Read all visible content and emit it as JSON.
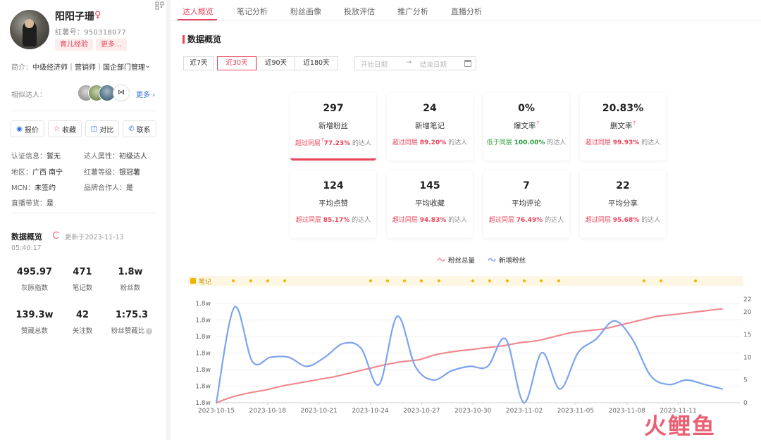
{
  "profile": {
    "name": "阳阳子珊",
    "gender_symbol": "♀",
    "red_id": "红薯号：950318077",
    "tags": [
      "育儿经验",
      "更多..."
    ],
    "bio_label": "简介：",
    "bio_text": "中级经济师｜营销师｜国企部门管理",
    "similar_label": "相似达人：",
    "similar_more": "更多",
    "actions": [
      "报价",
      "收藏",
      "对比",
      "联系"
    ],
    "info": [
      {
        "k": "认证信息：",
        "v": "暂无"
      },
      {
        "k": "达人属性：",
        "v": "初级达人"
      },
      {
        "k": "地区：",
        "v": "广西 南宁"
      },
      {
        "k": "红薯等级：",
        "v": "银冠薯"
      },
      {
        "k": "MCN：",
        "v": "未签约"
      },
      {
        "k": "品牌合作人：",
        "v": "是"
      },
      {
        "k": "直播带货：",
        "v": "是"
      }
    ],
    "overview_title": "数据概览",
    "updated_label": "更新于2023-11-13",
    "updated_time": "05:40:17",
    "stats": [
      {
        "value": "495.97",
        "label": "灰豚指数"
      },
      {
        "value": "471",
        "label": "笔记数"
      },
      {
        "value": "1.8w",
        "label": "粉丝数"
      },
      {
        "value": "139.3w",
        "label": "赞藏总数"
      },
      {
        "value": "42",
        "label": "关注数"
      },
      {
        "value": "1:75.3",
        "label": "粉丝赞藏比"
      }
    ]
  },
  "tabs": [
    "达人概览",
    "笔记分析",
    "粉丝画像",
    "投放评估",
    "推广分析",
    "直播分析"
  ],
  "active_tab": "达人概览",
  "section_title": "数据概览",
  "ranges": [
    "近7天",
    "近30天",
    "近90天",
    "近180天"
  ],
  "active_range": "近30天",
  "date_picker": {
    "start_placeholder": "开始日期",
    "end_placeholder": "结束日期"
  },
  "cards": [
    {
      "value": "297",
      "label": "新增粉丝",
      "prefix": "超过同层",
      "pct": "77.23%",
      "suffix": "的达人"
    },
    {
      "value": "24",
      "label": "新增笔记",
      "prefix": "超过同层",
      "pct": "89.20%",
      "suffix": "的达人"
    },
    {
      "value": "0%",
      "label": "爆文率",
      "prefix": "低于同层",
      "pct": "100.00%",
      "suffix": "的达人"
    },
    {
      "value": "20.83%",
      "label": "删文率",
      "prefix": "超过同层",
      "pct": "99.93%",
      "suffix": "的达人"
    },
    {
      "value": "124",
      "label": "平均点赞",
      "prefix": "超过同层",
      "pct": "85.17%",
      "suffix": "的达人"
    },
    {
      "value": "145",
      "label": "平均收藏",
      "prefix": "超过同层",
      "pct": "94.83%",
      "suffix": "的达人"
    },
    {
      "value": "7",
      "label": "平均评论",
      "prefix": "超过同层",
      "pct": "76.49%",
      "suffix": "的达人"
    },
    {
      "value": "22",
      "label": "平均分享",
      "prefix": "超过同层",
      "pct": "95.68%",
      "suffix": "的达人"
    }
  ],
  "legend": [
    "粉丝总量",
    "新增粉丝"
  ],
  "notes_label": "笔记",
  "watermark": "火鲤鱼",
  "colors": {
    "accent": "#e8445a",
    "total_line": "#f08a8f",
    "new_line": "#7ba3f0",
    "note_dot": "#f0b400",
    "green": "#2e9a3a"
  },
  "chart_data": {
    "type": "line",
    "x_tick_labels": [
      "2023-10-15",
      "2023-10-18",
      "2023-10-21",
      "2023-10-24",
      "2023-10-27",
      "2023-10-30",
      "2023-11-02",
      "2023-11-05",
      "2023-11-08",
      "2023-11-11"
    ],
    "y_left_tick_labels": [
      "1.8w",
      "1.8w",
      "1.8w",
      "1.8w",
      "1.8w",
      "1.8w",
      "1.8w"
    ],
    "y_right_ticks": [
      0,
      5,
      10,
      15,
      20,
      22
    ],
    "y_right_range": [
      0,
      22
    ],
    "grid": true,
    "legend_position": "top-center",
    "series": [
      {
        "name": "粉丝总量",
        "axis": "left",
        "values": [
          0.0,
          0.06,
          0.1,
          0.13,
          0.17,
          0.2,
          0.23,
          0.26,
          0.3,
          0.34,
          0.38,
          0.41,
          0.43,
          0.48,
          0.51,
          0.53,
          0.55,
          0.57,
          0.6,
          0.62,
          0.66,
          0.7,
          0.72,
          0.74,
          0.78,
          0.82,
          0.86,
          0.88,
          0.9,
          0.92,
          0.94
        ]
      },
      {
        "name": "新增粉丝",
        "axis": "right",
        "values": [
          0,
          21,
          9,
          10,
          10,
          8,
          10,
          13,
          12,
          4,
          19,
          8,
          5,
          7,
          8,
          8,
          14,
          0,
          11,
          3,
          11,
          14,
          18,
          14,
          6,
          4,
          5,
          4,
          3
        ]
      }
    ],
    "note_days": [
      "2023-10-16",
      "2023-10-17",
      "2023-10-18",
      "2023-10-19",
      "2023-10-24",
      "2023-10-25",
      "2023-10-26",
      "2023-10-27",
      "2023-10-28",
      "2023-10-30",
      "2023-10-31",
      "2023-11-01",
      "2023-11-02",
      "2023-11-03",
      "2023-11-04",
      "2023-11-09",
      "2023-11-10",
      "2023-11-12"
    ]
  }
}
